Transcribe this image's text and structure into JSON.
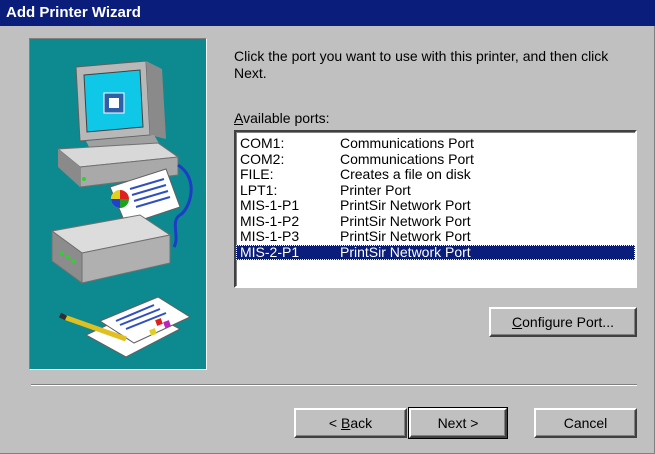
{
  "window": {
    "title": "Add Printer Wizard"
  },
  "instructions": "Click the port you want to use with this printer, and then click Next.",
  "ports": {
    "label_accel": "A",
    "label_rest": "vailable ports:",
    "items": [
      {
        "name": "COM1:",
        "desc": "Communications Port",
        "selected": false
      },
      {
        "name": "COM2:",
        "desc": "Communications Port",
        "selected": false
      },
      {
        "name": "FILE:",
        "desc": "Creates a file on disk",
        "selected": false
      },
      {
        "name": "LPT1:",
        "desc": "Printer Port",
        "selected": false
      },
      {
        "name": "MIS-1-P1",
        "desc": "PrintSir Network Port",
        "selected": false
      },
      {
        "name": "MIS-1-P2",
        "desc": "PrintSir Network Port",
        "selected": false
      },
      {
        "name": "MIS-1-P3",
        "desc": "PrintSir Network Port",
        "selected": false
      },
      {
        "name": "MIS-2-P1",
        "desc": "PrintSir Network Port",
        "selected": true
      }
    ]
  },
  "buttons": {
    "configure_accel": "C",
    "configure_rest": "onfigure Port...",
    "back_prefix": "< ",
    "back_accel": "B",
    "back_rest": "ack",
    "next": "Next >",
    "cancel": "Cancel"
  },
  "colors": {
    "titlebar": "#0a1d7a",
    "selection": "#0a1d7a",
    "illustration_bg": "#0d8a8f",
    "face": "#c0c0c0"
  },
  "icons": [
    "computer-icon",
    "printer-icon",
    "documents-icon"
  ]
}
